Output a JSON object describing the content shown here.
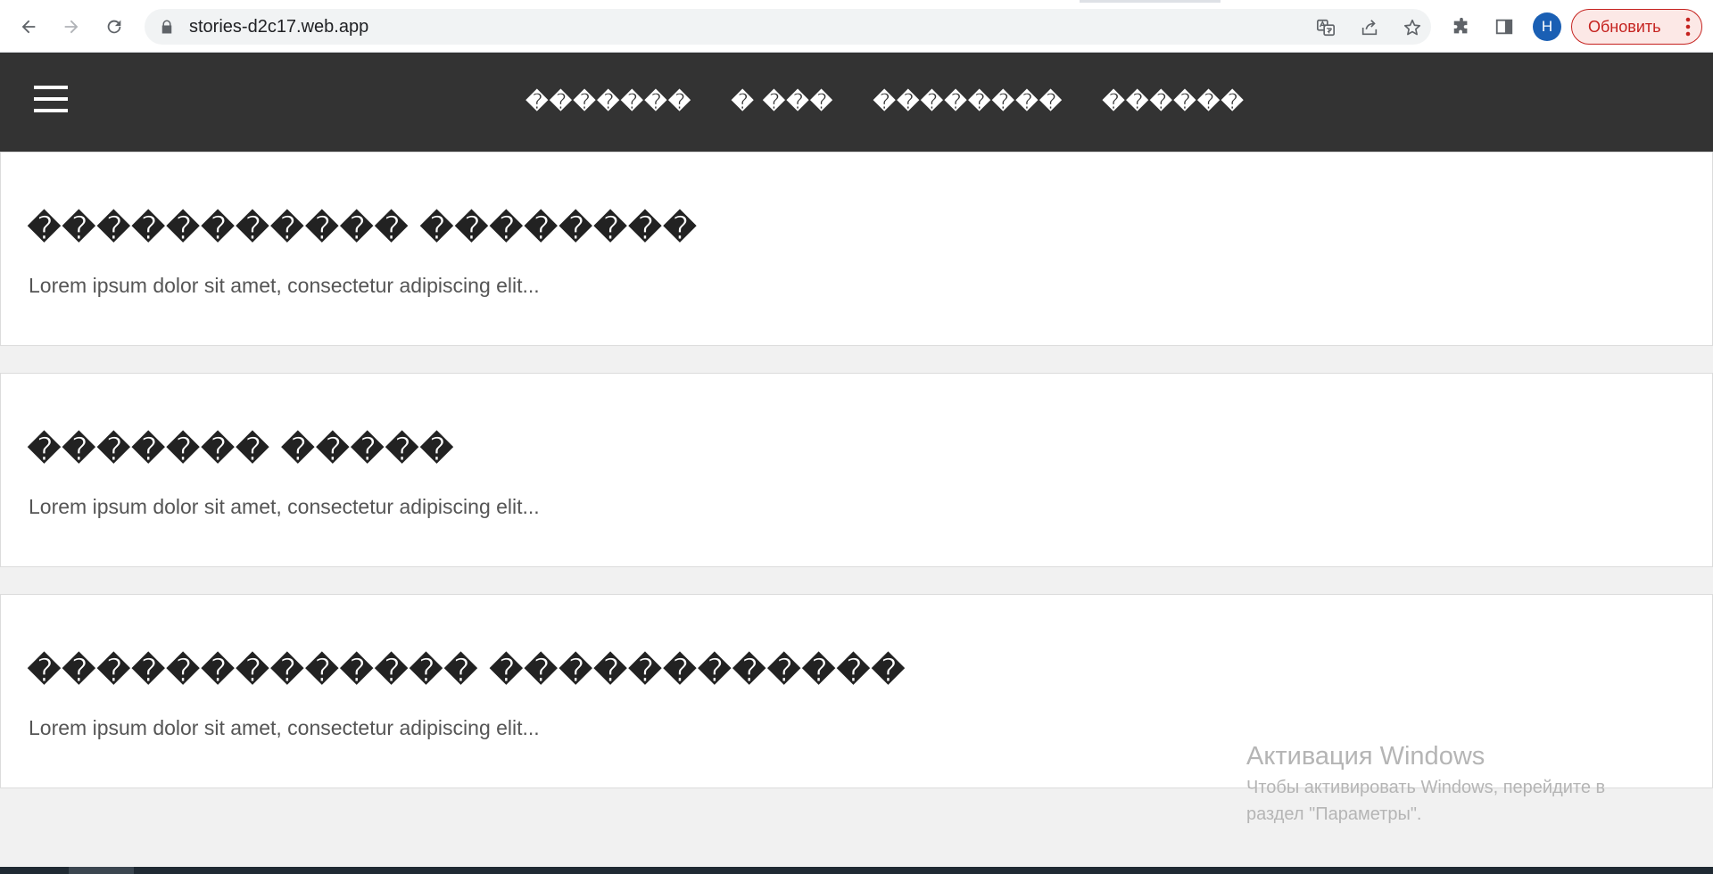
{
  "browser": {
    "url": "stories-d2c17.web.app",
    "profile_initial": "Н",
    "update_label": "Обновить",
    "icons": [
      "back-icon",
      "forward-icon",
      "reload-icon",
      "lock-icon",
      "translate-icon",
      "share-icon",
      "star-icon",
      "extensions-icon",
      "side-panel-icon",
      "more-icon"
    ]
  },
  "site": {
    "nav": [
      {
        "label": "�������"
      },
      {
        "label": "� ���"
      },
      {
        "label": "��������"
      },
      {
        "label": "������"
      }
    ]
  },
  "cards": [
    {
      "title": "����������� ��������",
      "text": "Lorem ipsum dolor sit amet, consectetur adipiscing elit..."
    },
    {
      "title": "������� �����",
      "text": "Lorem ipsum dolor sit amet, consectetur adipiscing elit..."
    },
    {
      "title": "������������� ������������",
      "text": "Lorem ipsum dolor sit amet, consectetur adipiscing elit..."
    }
  ],
  "watermark": {
    "title": "Активация Windows",
    "line1": "Чтобы активировать Windows, перейдите в",
    "line2": "раздел \"Параметры\"."
  },
  "colors": {
    "header_bg": "#333333",
    "page_bg": "#f1f1f1",
    "update_accent": "#c5221f",
    "avatar_bg": "#1a5fb4"
  }
}
